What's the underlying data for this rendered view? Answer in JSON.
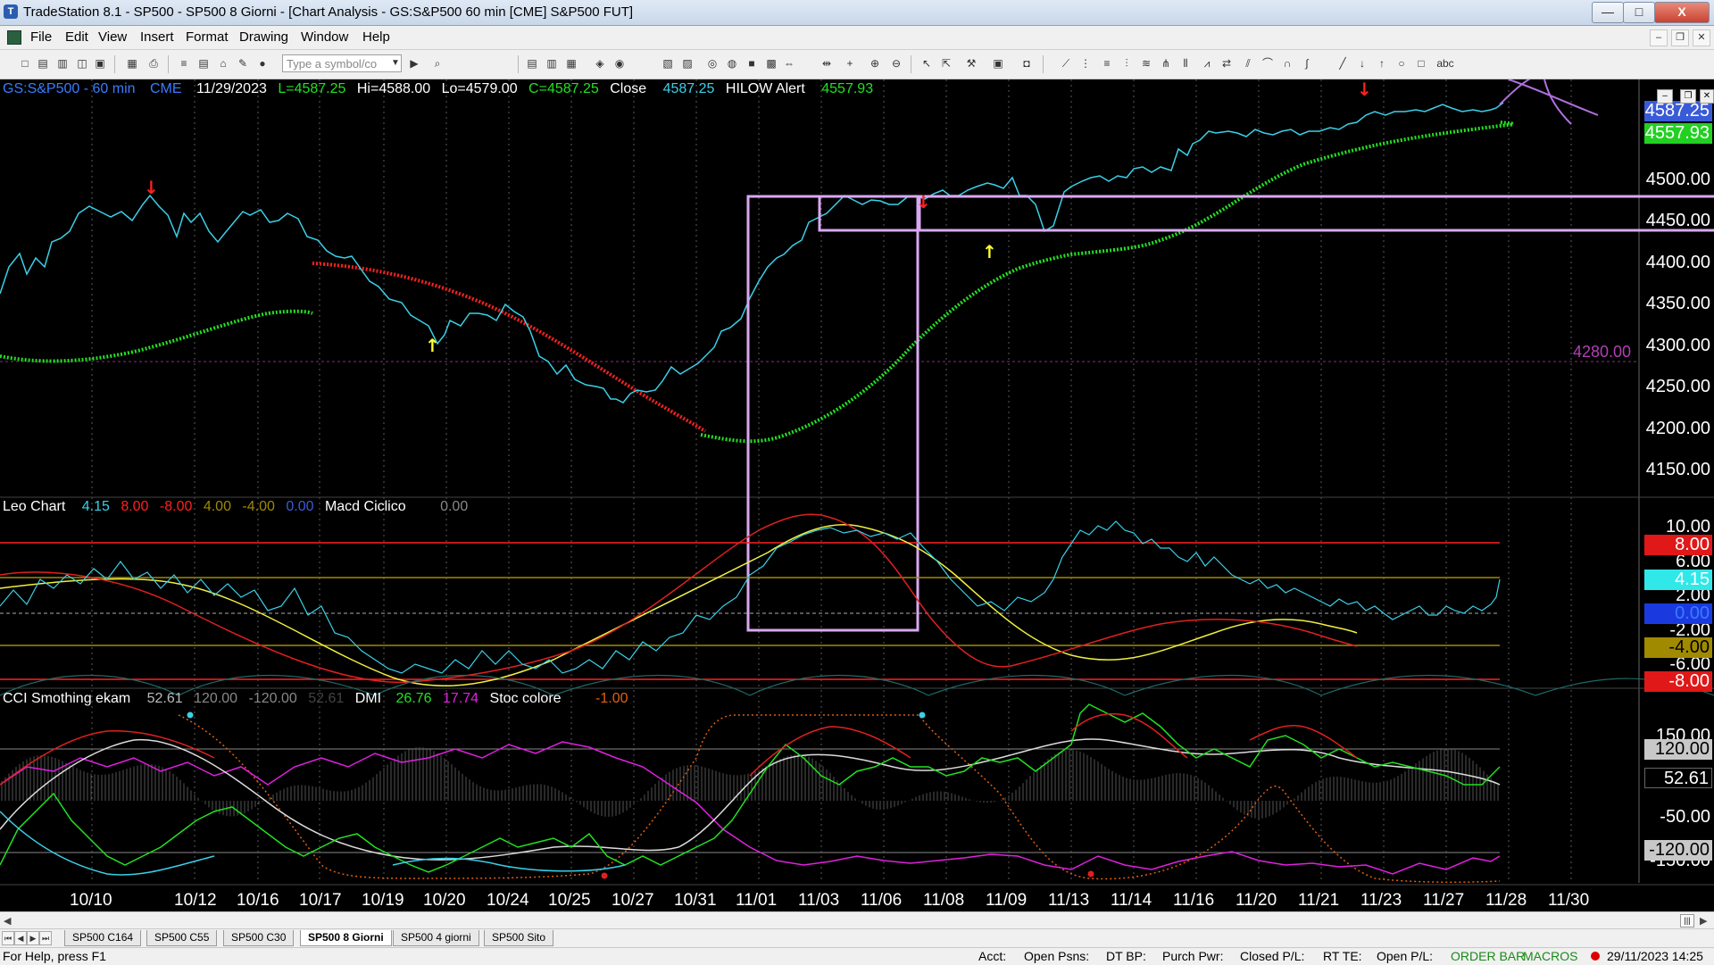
{
  "window": {
    "title": "TradeStation 8.1 - SP500 - SP500 8 Giorni - [Chart Analysis - GS:S&P500  60 min  [CME] S&P500 FUT]",
    "minimize": "—",
    "maximize": "□",
    "close": "X"
  },
  "menu": [
    "File",
    "Edit",
    "View",
    "Insert",
    "Format",
    "Drawing",
    "Window",
    "Help"
  ],
  "toolbar": {
    "symbol_placeholder": "Type a symbol/co"
  },
  "price_header": {
    "symbol": "GS:S&P500 - 60 min",
    "exchange": "CME",
    "date": "11/29/2023",
    "last": "L=4587.25",
    "high": "Hi=4588.00",
    "low": "Lo=4579.00",
    "close": "C=4587.25",
    "close_label": "Close",
    "close_value": "4587.25",
    "alert_label": "HILOW Alert",
    "alert_value": "4557.93"
  },
  "price_axis": [
    "4500.00",
    "4450.00",
    "4400.00",
    "4350.00",
    "4300.00",
    "4250.00",
    "4200.00",
    "4150.00"
  ],
  "price_badges": {
    "last": "4587.25",
    "alert": "4557.93",
    "level_label": "4280.00"
  },
  "leo_header": {
    "name": "Leo Chart",
    "v1": "4.15",
    "v2": "8.00",
    "v3": "-8.00",
    "v4": "4.00",
    "v5": "-4.00",
    "v6": "0.00",
    "macd_label": "Macd Ciclico",
    "macd_value": "0.00"
  },
  "leo_axis": [
    "10.00",
    "6.00",
    "2.00",
    "-2.00",
    "-6.00"
  ],
  "leo_badges": {
    "b8": "8.00",
    "b415": "4.15",
    "b0": "0.00",
    "bm4": "-4.00",
    "bm8": "-8.00"
  },
  "cci_header": {
    "name": "CCI Smothing ekam",
    "v1": "52.61",
    "v2": "120.00",
    "v3": "-120.00",
    "v4": "52.61",
    "dmi_label": "DMI",
    "dmi1": "26.76",
    "dmi2": "17.74",
    "stoc_label": "Stoc colore",
    "stoc_value": "-1.00"
  },
  "cci_axis": [
    "150.00",
    "-50.00",
    "-150.00"
  ],
  "cci_badges": {
    "b120": "120.00",
    "b52": "52.61",
    "bm120": "-120.00"
  },
  "x_ticks": [
    "10/10",
    "10/12",
    "10/16",
    "10/17",
    "10/19",
    "10/20",
    "10/24",
    "10/25",
    "10/27",
    "10/31",
    "11/01",
    "11/03",
    "11/06",
    "11/08",
    "11/09",
    "11/13",
    "11/14",
    "11/16",
    "11/20",
    "11/21",
    "11/23",
    "11/27",
    "11/28",
    "11/30"
  ],
  "tabs": [
    "SP500 C164",
    "SP500 C55",
    "SP500 C30",
    "SP500 8 Giorni",
    "SP500 4 giorni",
    "SP500 Sito"
  ],
  "active_tab": "SP500 8 Giorni",
  "status": {
    "help": "For Help, press F1",
    "acct": "Acct:",
    "open_psns": "Open Psns:",
    "dt_bp": "DT BP:",
    "purch_pwr": "Purch Pwr:",
    "closed_pl": "Closed P/L:",
    "rt_te": "RT TE:",
    "open_pl": "Open P/L:",
    "order_bar": "ORDER BAR",
    "macros": "MACROS",
    "datetime": "29/11/2023 14:25"
  },
  "colors": {
    "price": "#3ad0e8",
    "support": "#22e022",
    "resistance": "#ff2020",
    "box": "#d9a8f0",
    "yellow": "#ffff30"
  }
}
